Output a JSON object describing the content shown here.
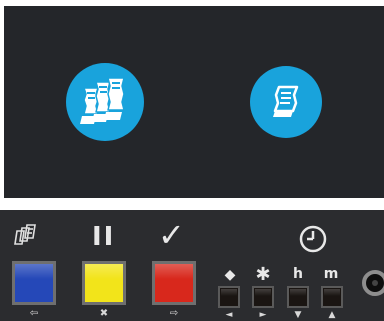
{
  "screen": {
    "buttons": [
      {
        "name": "multi-receipt-button",
        "icon": "multi-document-icon"
      },
      {
        "name": "single-receipt-button",
        "icon": "document-icon"
      }
    ]
  },
  "panel": {
    "top_symbols": {
      "pause": "II",
      "check": "✓",
      "diamond": "◆",
      "star": "✱",
      "h": "h",
      "m": "m"
    },
    "keys": [
      {
        "name": "blue-key",
        "color": "#2548b8",
        "sub": "⇦"
      },
      {
        "name": "yellow-key",
        "color": "#f2e41a",
        "sub": "✖"
      },
      {
        "name": "red-key",
        "color": "#d8281c",
        "sub": "⇨"
      }
    ],
    "small_keys": [
      {
        "name": "diamond-key",
        "sub": "◄"
      },
      {
        "name": "star-key",
        "sub": "►"
      },
      {
        "name": "h-key",
        "sub": "▼"
      },
      {
        "name": "m-key",
        "sub": "▲"
      }
    ],
    "accent": "#19a3dc"
  }
}
